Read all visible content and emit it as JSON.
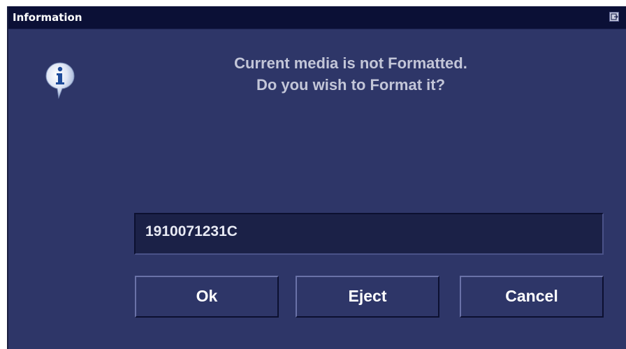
{
  "dialog": {
    "title": "Information",
    "title_icon": "restore-icon",
    "message_line1": "Current media is not Formatted.",
    "message_line2": "Do you wish to Format it?",
    "icon": "info-icon",
    "media_id": "1910071231C"
  },
  "buttons": {
    "ok_label": "Ok",
    "eject_label": "Eject",
    "cancel_label": "Cancel"
  },
  "colors": {
    "background": "#2e3668",
    "titlebar": "#0b1036",
    "message_text": "#c3c6d8",
    "field_background": "#1b2147"
  }
}
